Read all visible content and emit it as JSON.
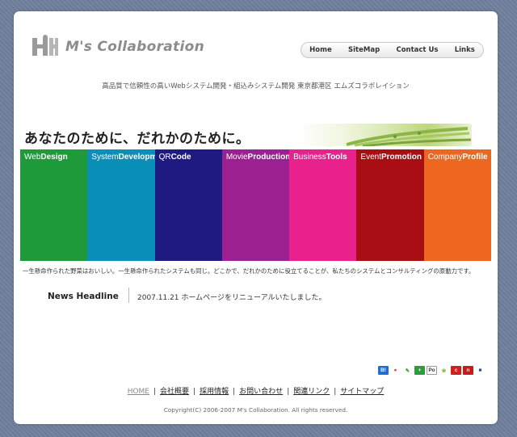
{
  "header": {
    "logo_text": "M's Collaboration",
    "nav": [
      "Home",
      "SiteMap",
      "Contact Us",
      "Links"
    ]
  },
  "tagline": "高品質で信頼性の高いWebシステム開発・組込みシステム開発 東京都港区 エムズコラボレイション",
  "catchcopy": "あなたのために、だれかのために。",
  "categories": [
    {
      "light": "Web",
      "bold": "Design",
      "color": "#1e9a3a"
    },
    {
      "light": "System",
      "bold": "Development",
      "color": "#0a8fb8"
    },
    {
      "light": "QR",
      "bold": "Code",
      "color": "#1e1a82"
    },
    {
      "light": "Movie",
      "bold": "Production",
      "color": "#9b2190"
    },
    {
      "light": "Business",
      "bold": "Tools",
      "color": "#e8218d"
    },
    {
      "light": "Event",
      "bold": "Promotion",
      "color": "#a80e14"
    },
    {
      "light": "Company",
      "bold": "Profile",
      "color": "#ee6721"
    }
  ],
  "subtext": "一生懸命作られた野菜はおいしい。一生懸命作られたシステムも同じ。どこかで、だれかのために役立てることが、私たちのシステムとコンサルティングの原動力です。",
  "news": {
    "heading": "News Headline",
    "item": "2007.11.21 ホームページをリニューアルいたしました。"
  },
  "bookmark_icons": [
    {
      "name": "hatena-bookmark-icon",
      "label": "B!",
      "color": "#1d6fd0"
    },
    {
      "name": "buzzurl-icon",
      "label": "●",
      "color": "#d9472b"
    },
    {
      "name": "livedoor-clip-icon",
      "label": "✎",
      "color": "#3f9b2f"
    },
    {
      "name": "yahoo-bookmark-icon",
      "label": "+",
      "color": "#2e9b3c"
    },
    {
      "name": "pookmark-icon",
      "label": "Po",
      "color": "#333333"
    },
    {
      "name": "choix-icon",
      "label": "❀",
      "color": "#7bbf3a"
    },
    {
      "name": "nifty-clip-icon",
      "label": "c",
      "color": "#d21f1f"
    },
    {
      "name": "newsing-icon",
      "label": "n",
      "color": "#cc1a1a"
    },
    {
      "name": "delicious-icon",
      "label": "■",
      "color": "#1f4aa8"
    }
  ],
  "footer": {
    "links": [
      "HOME",
      "会社概要",
      "採用情報",
      "お問い合わせ",
      "関連リンク",
      "サイトマップ"
    ],
    "copyright": "Copyright(C) 2006-2007 M's Collaboration. All rights reserved."
  }
}
